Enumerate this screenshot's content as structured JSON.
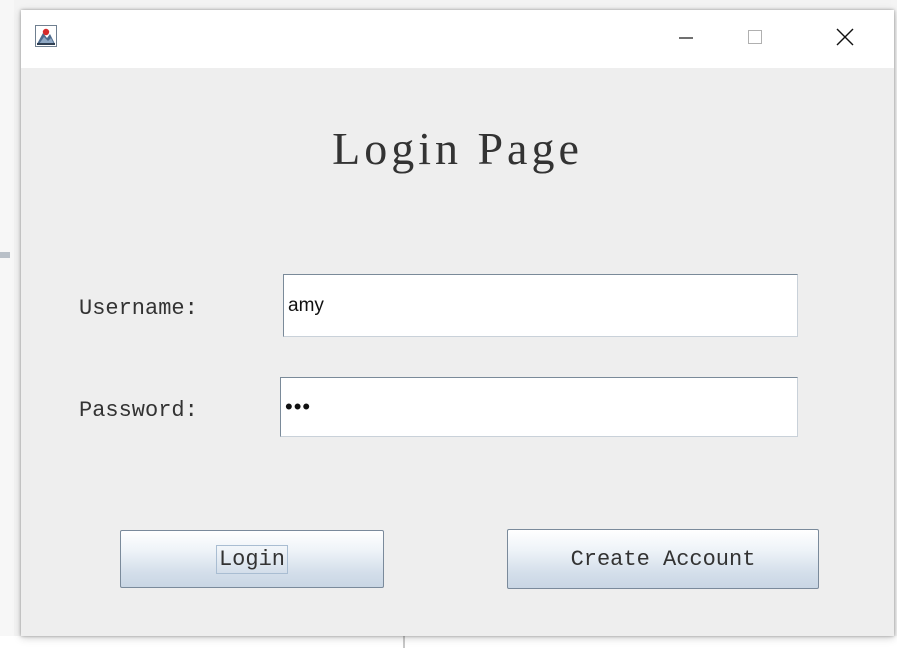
{
  "window": {
    "heading": "Login Page"
  },
  "titlebar": {
    "app_icon": "java-app-icon",
    "minimize_icon": "minimize-icon",
    "maximize_icon": "maximize-icon",
    "close_icon": "close-icon"
  },
  "form": {
    "username_label": "Username:",
    "username_value": "amy",
    "password_label": "Password:",
    "password_value": "•••"
  },
  "buttons": {
    "login_label": "Login",
    "create_account_label": "Create Account"
  },
  "colors": {
    "window_bg": "#eeeeee",
    "titlebar_bg": "#ffffff",
    "text": "#333333",
    "button_border": "#7a8a9b"
  }
}
